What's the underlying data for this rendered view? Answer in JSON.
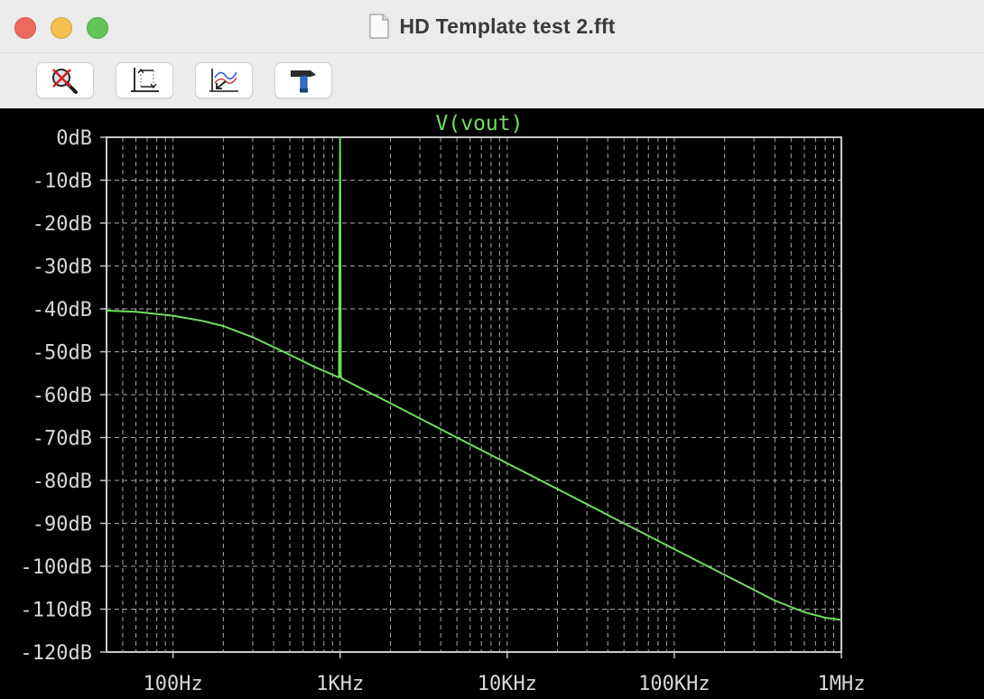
{
  "window": {
    "title": "HD Template test 2.fft"
  },
  "toolbar": {
    "buttons": [
      {
        "name": "autorange-disable-button",
        "icon": "magnifier-cross-icon"
      },
      {
        "name": "fit-axes-button",
        "icon": "axes-fit-icon"
      },
      {
        "name": "zoom-back-button",
        "icon": "waveform-arrow-icon"
      },
      {
        "name": "tools-button",
        "icon": "hammer-icon"
      }
    ]
  },
  "colors": {
    "trace": "#6ee05c",
    "grid": "#c8c8c8",
    "axis_text": "#d8d8d8",
    "background": "#000000"
  },
  "chart_data": {
    "type": "line",
    "title": "V(vout)",
    "x_scale": "log",
    "y_scale": "linear",
    "xlim": [
      40,
      1000000
    ],
    "ylim": [
      -120,
      0
    ],
    "grid": true,
    "x_tick_labels": [
      {
        "value": 100,
        "label": "100Hz"
      },
      {
        "value": 1000,
        "label": "1KHz"
      },
      {
        "value": 10000,
        "label": "10KHz"
      },
      {
        "value": 100000,
        "label": "100KHz"
      },
      {
        "value": 1000000,
        "label": "1MHz"
      }
    ],
    "y_tick_labels": [
      {
        "value": 0,
        "label": "0dB"
      },
      {
        "value": -10,
        "label": "-10dB"
      },
      {
        "value": -20,
        "label": "-20dB"
      },
      {
        "value": -30,
        "label": "-30dB"
      },
      {
        "value": -40,
        "label": "-40dB"
      },
      {
        "value": -50,
        "label": "-50dB"
      },
      {
        "value": -60,
        "label": "-60dB"
      },
      {
        "value": -70,
        "label": "-70dB"
      },
      {
        "value": -80,
        "label": "-80dB"
      },
      {
        "value": -90,
        "label": "-90dB"
      },
      {
        "value": -100,
        "label": "-100dB"
      },
      {
        "value": -110,
        "label": "-110dB"
      },
      {
        "value": -120,
        "label": "-120dB"
      }
    ],
    "series": [
      {
        "name": "V(vout)",
        "x": [
          40,
          60,
          100,
          150,
          200,
          300,
          500,
          700,
          970,
          985,
          1000,
          1010,
          1020,
          2000,
          5000,
          10000,
          20000,
          50000,
          100000,
          200000,
          400000,
          600000,
          800000,
          1000000
        ],
        "y": [
          -40.4,
          -40.7,
          -41.6,
          -42.8,
          -44.0,
          -46.6,
          -50.7,
          -53.5,
          -55.9,
          -56.0,
          0,
          -55.5,
          -56.2,
          -62.0,
          -70.0,
          -76.0,
          -82.0,
          -90.0,
          -96.0,
          -102.0,
          -108.0,
          -110.7,
          -112.0,
          -112.5
        ]
      }
    ]
  }
}
